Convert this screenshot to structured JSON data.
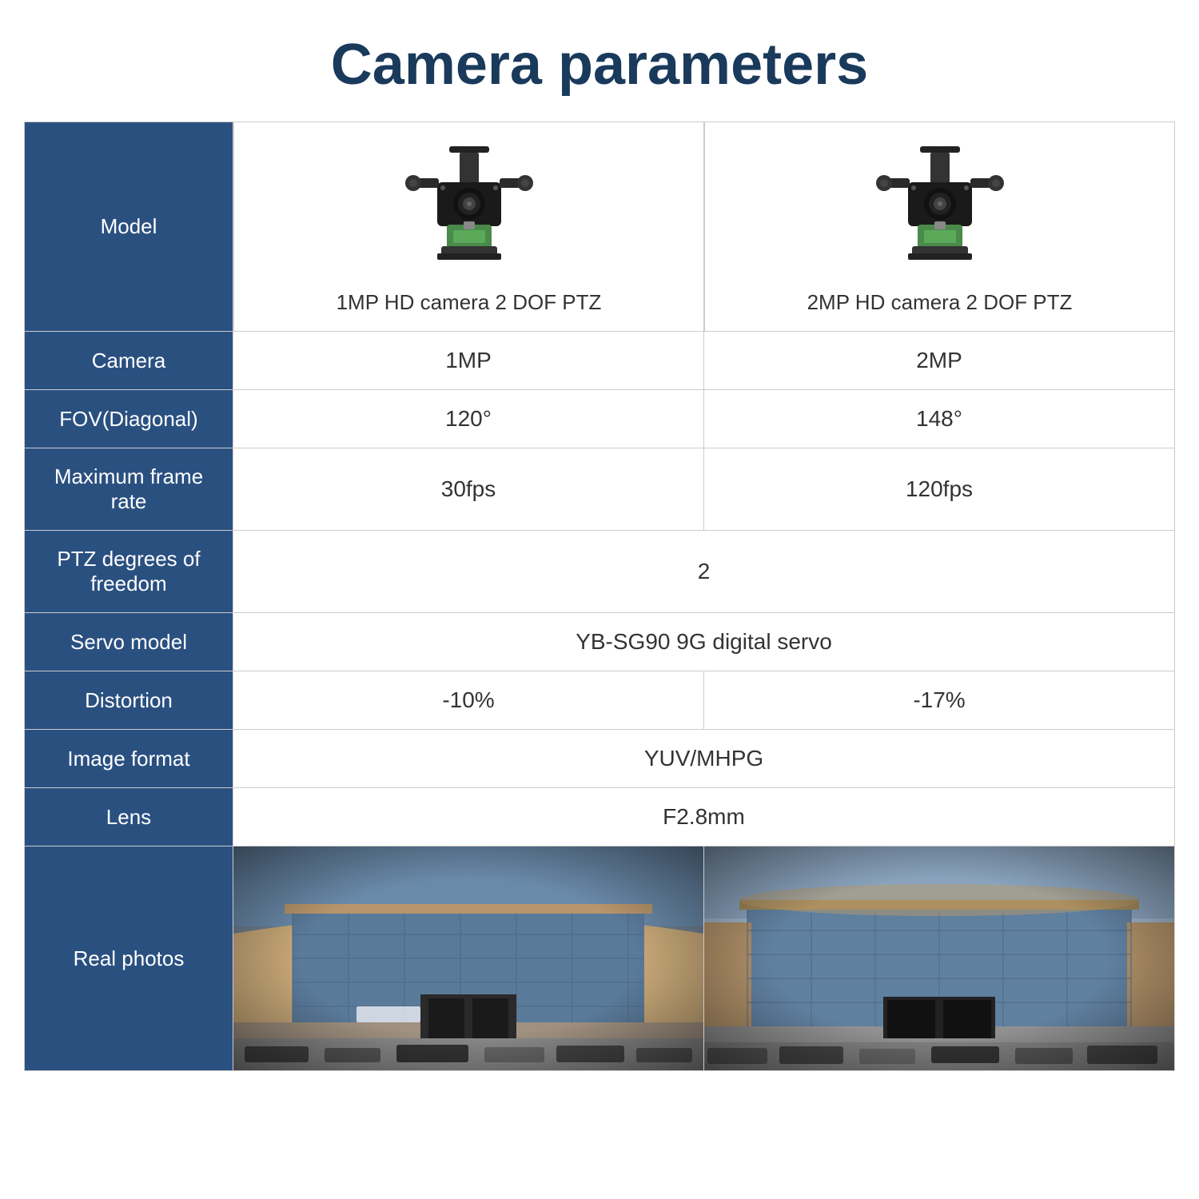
{
  "title": "Camera parameters",
  "colors": {
    "sidebar": "#2a5080",
    "header_text": "#1a3a5c",
    "border": "#ccc",
    "text": "#333",
    "text_light": "#fff"
  },
  "rows": [
    {
      "id": "model",
      "label": "Model",
      "type": "model",
      "col1_name": "1MP HD camera 2 DOF PTZ",
      "col2_name": "2MP HD camera 2 DOF PTZ"
    },
    {
      "id": "camera",
      "label": "Camera",
      "type": "split",
      "col1": "1MP",
      "col2": "2MP"
    },
    {
      "id": "fov",
      "label": "FOV(Diagonal)",
      "type": "split",
      "col1": "120°",
      "col2": "148°"
    },
    {
      "id": "frame-rate",
      "label": "Maximum frame rate",
      "type": "split",
      "col1": "30fps",
      "col2": "120fps"
    },
    {
      "id": "ptz",
      "label": "PTZ degrees of freedom",
      "type": "full",
      "value": "2"
    },
    {
      "id": "servo",
      "label": "Servo model",
      "type": "full",
      "value": "YB-SG90 9G digital servo"
    },
    {
      "id": "distortion",
      "label": "Distortion",
      "type": "split",
      "col1": "-10%",
      "col2": "-17%"
    },
    {
      "id": "image-format",
      "label": "Image format",
      "type": "full",
      "value": "YUV/MHPG"
    },
    {
      "id": "lens",
      "label": "Lens",
      "type": "full",
      "value": "F2.8mm"
    },
    {
      "id": "photos",
      "label": "Real photos",
      "type": "photos"
    }
  ]
}
